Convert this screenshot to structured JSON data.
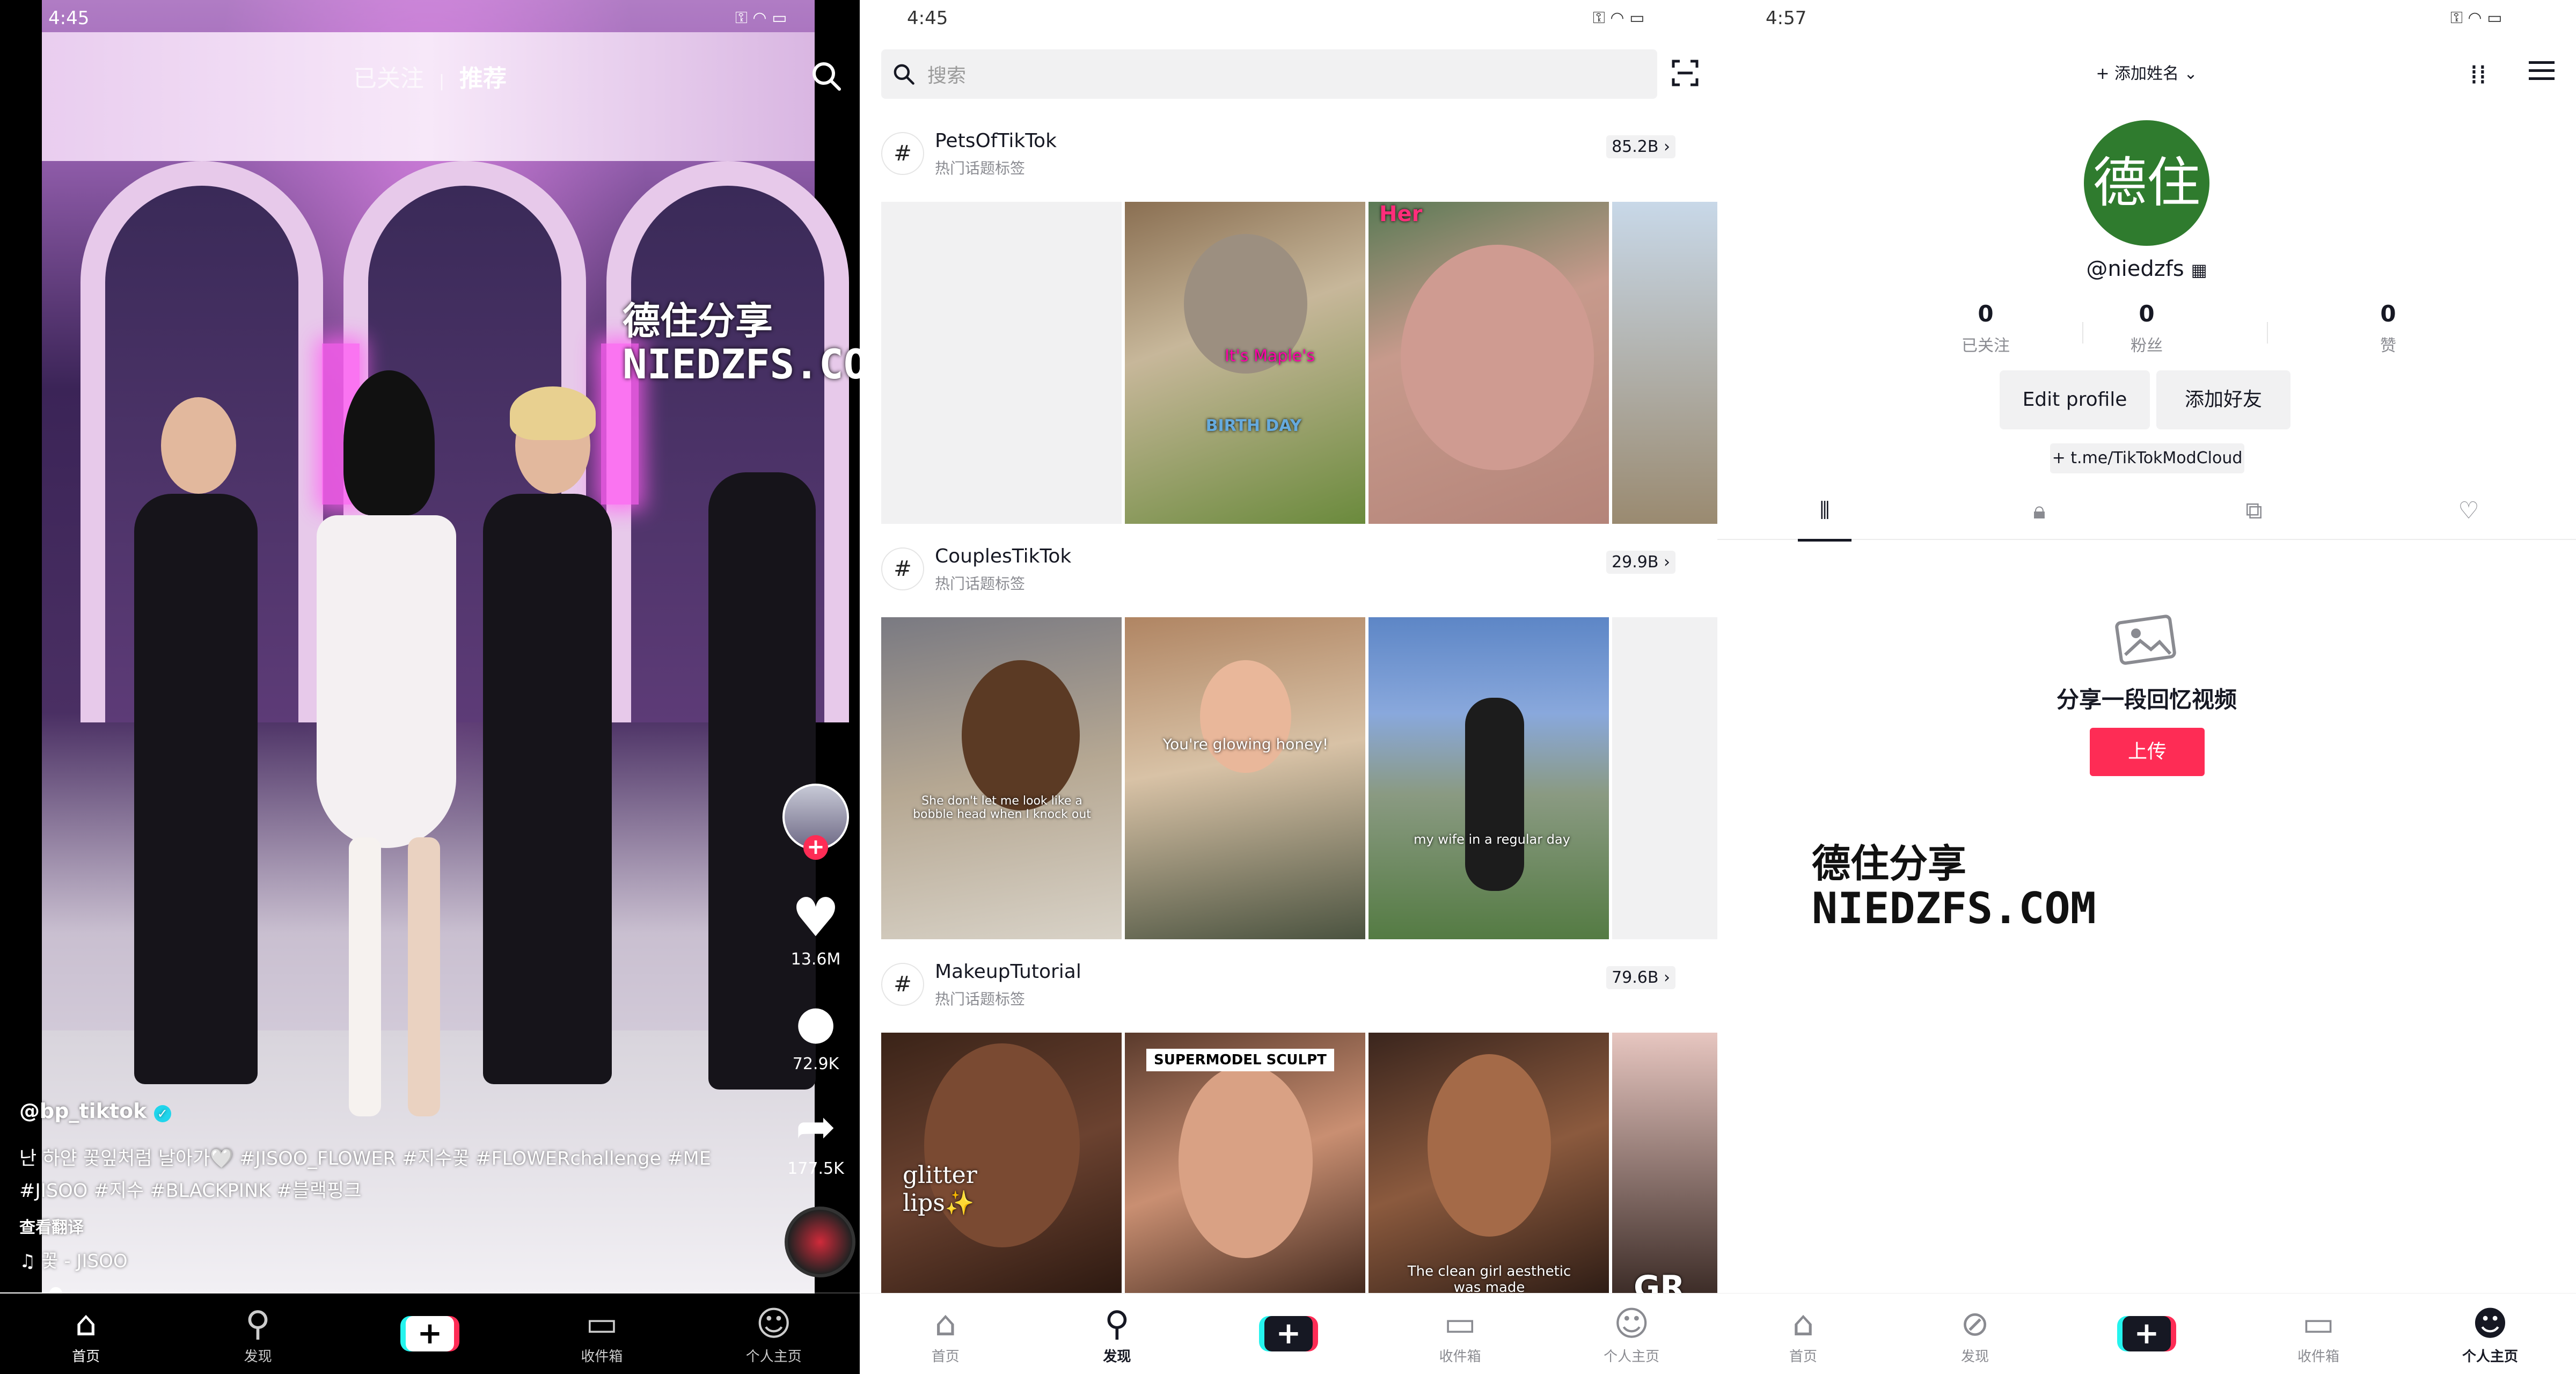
{
  "colors": {
    "accent": "#fe2c55",
    "teal": "#25f4ee",
    "verified": "#20d5ec",
    "avatar_bg": "#2f7b2e"
  },
  "feed": {
    "status_time": "4:45",
    "tabs": {
      "following": "已关注",
      "for_you": "推荐"
    },
    "like_count": "13.6M",
    "comment_count": "72.9K",
    "share_count": "177.5K",
    "username": "@bp_tiktok",
    "caption_line1": "난 하얀 꽃잎처럼 날아가🤍 #JISOO_FLOWER #지수꽃 #FLOWERchallenge #ME",
    "caption_line2": "#JISOO #지수 #BLACKPINK #블랙핑크",
    "translate": "查看翻译",
    "sound": "꽃 - JISOO",
    "progress": 0.05,
    "watermark_line1": "德住分享",
    "watermark_line2": "NIEDZFS.COM"
  },
  "nav": {
    "home": "首页",
    "discover": "发现",
    "inbox": "收件箱",
    "profile": "个人主页"
  },
  "discover": {
    "status_time": "4:45",
    "search_placeholder": "搜索",
    "sections": [
      {
        "title": "PetsOfTikTok",
        "subtitle": "热门话题标签",
        "count": "85.2B",
        "overlays": [
          "",
          "It's Maple's",
          "BIRTH DAY",
          "Her",
          ""
        ]
      },
      {
        "title": "CouplesTikTok",
        "subtitle": "热门话题标签",
        "count": "29.9B",
        "overlays": [
          "She don't let me look like a bobble head when I knock out",
          "You're glowing honey!",
          "my wife in a regular day",
          ""
        ]
      },
      {
        "title": "MakeupTutorial",
        "subtitle": "热门话题标签",
        "count": "79.6B",
        "overlays": [
          "glitter lips✨",
          "SUPERMODEL SCULPT",
          "The clean girl aesthetic was made",
          "GR"
        ]
      }
    ]
  },
  "profile": {
    "status_time": "4:57",
    "add_name": "+ 添加姓名",
    "avatar_text": "德住",
    "handle": "@niedzfs",
    "following_count": "0",
    "following_label": "已关注",
    "followers_count": "0",
    "followers_label": "粉丝",
    "likes_count": "0",
    "likes_label": "赞",
    "edit_profile": "Edit profile",
    "add_friends": "添加好友",
    "link": "+ t.me/TikTokModCloud",
    "empty_title": "分享一段回忆视频",
    "upload": "上传",
    "watermark_line1": "德住分享",
    "watermark_line2": "NIEDZFS.COM"
  }
}
